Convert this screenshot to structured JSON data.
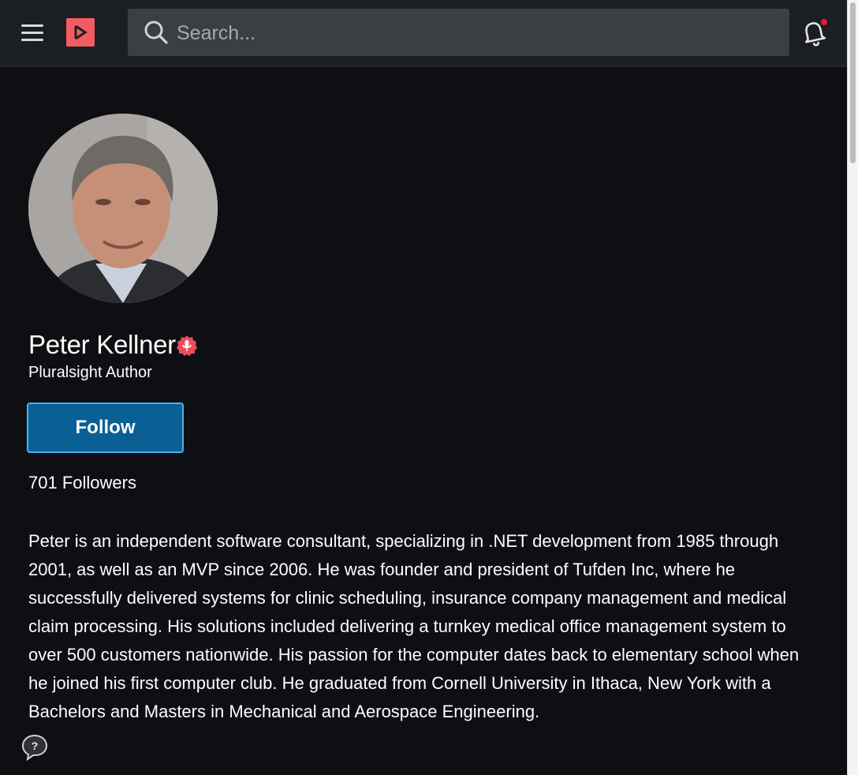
{
  "header": {
    "menu_icon": "hamburger-menu-icon",
    "logo_icon": "pluralsight-play-logo",
    "search": {
      "placeholder": "Search...",
      "value": ""
    },
    "notifications_icon": "bell-icon",
    "notification_dot_color": "#e41b23"
  },
  "profile": {
    "name": "Peter Kellner",
    "badge_icon": "author-microphone-badge",
    "role": "Pluralsight Author",
    "follow_label": "Follow",
    "followers": "701 Followers",
    "bio": "Peter is an independent software consultant, specializing in .NET development from 1985 through 2001, as well as an MVP since 2006. He was founder and president of Tufden Inc, where he successfully delivered systems for clinic scheduling, insurance company management and medical claim processing. His solutions included delivering a turnkey medical office management system to over 500 customers nationwide. His passion for the computer dates back to elementary school when he joined his first computer club. He graduated from Cornell University in Ithaca, New York with a Bachelors and Masters in Mechanical and Aerospace Engineering."
  },
  "help_icon": "help-chat-icon",
  "colors": {
    "background": "#0e0f12",
    "header": "#1b1e22",
    "search": "#3b3f44",
    "brand": "#f15b62",
    "follow_button": "#0a5f95",
    "follow_border": "#4db1e8"
  }
}
